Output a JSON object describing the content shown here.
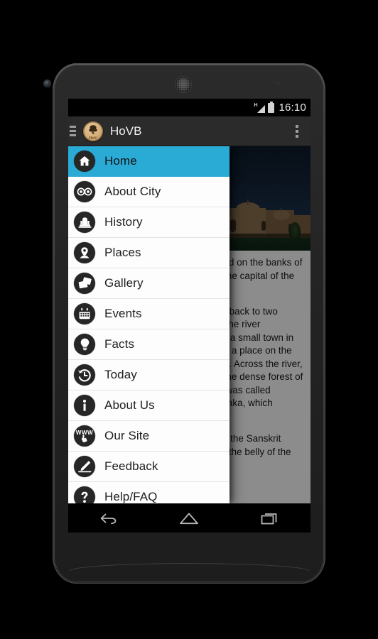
{
  "device": {
    "hardware": {
      "front_camera": "front-camera",
      "earpiece": "earpiece-speaker",
      "proximity_sensor": "proximity-sensor"
    }
  },
  "status_bar": {
    "network_type": "H",
    "signal_icon": "signal-bars-icon",
    "battery_icon": "battery-full-icon",
    "clock": "16:10"
  },
  "action_bar": {
    "drawer_toggle_icon": "hamburger-icon",
    "logo_icon": "tree-logo-icon",
    "logo_word": "HoV",
    "title": "HoVB",
    "overflow_icon": "overflow-menu-icon"
  },
  "drawer": {
    "selected_index": 0,
    "highlight_color": "#2aabd6",
    "items": [
      {
        "label": "Home",
        "icon": "home-icon"
      },
      {
        "label": "About City",
        "icon": "glasses-icon"
      },
      {
        "label": "History",
        "icon": "monument-icon"
      },
      {
        "label": "Places",
        "icon": "map-pin-icon"
      },
      {
        "label": "Gallery",
        "icon": "photos-icon"
      },
      {
        "label": "Events",
        "icon": "calendar-icon"
      },
      {
        "label": "Facts",
        "icon": "lightbulb-icon"
      },
      {
        "label": "Today",
        "icon": "clock-history-icon"
      },
      {
        "label": "About Us",
        "icon": "info-icon"
      },
      {
        "label": "Our Site",
        "icon": "www-cursor-icon"
      },
      {
        "label": "Feedback",
        "icon": "pencil-icon"
      },
      {
        "label": "Help/FAQ",
        "icon": "question-icon"
      }
    ]
  },
  "content": {
    "hero_image_alt": "laxmi-vilas-palace-photo",
    "paragraphs": [
      "Vadodara is a city in Gujarat, situated on the banks of the river Vishwamitri. It was earlier the capital of the Baroda princely state.",
      "Vadodara has a rich heritage dating back to two thousand years. Settlements along the river Vishwamitri thrived here. There was a small town in ancient times called Ankottaka, near a place on the right bank which is now called Akota. Across the river, to its east, a settlement grew up in the dense forest of vad or banyan trees, and the place was called Vadpatraka or Vatodar, or Vadapadraka, which means a village in a banyan grove.",
      "The name Vadodara is derived from the Sanskrit word Vatodar, which word means in the belly of the banyan tree."
    ]
  },
  "nav_bar": {
    "back_icon": "back-arrow-icon",
    "home_icon": "home-nav-icon",
    "recents_icon": "recents-icon"
  }
}
